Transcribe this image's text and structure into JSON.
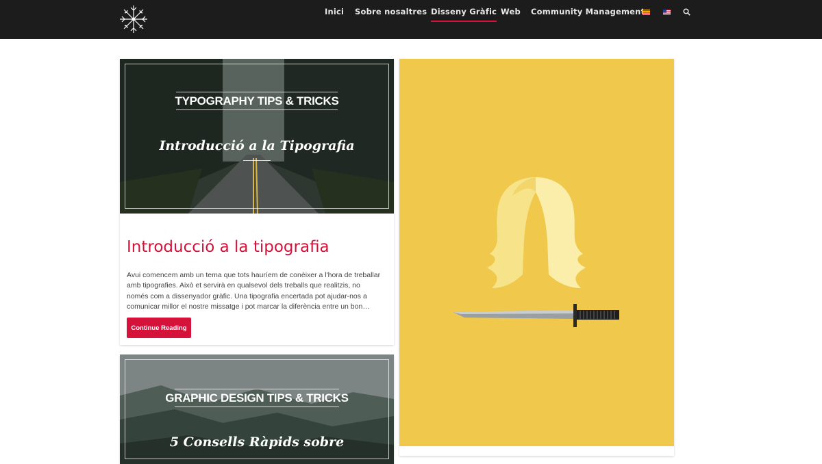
{
  "header": {
    "nav": [
      {
        "label": "Inici"
      },
      {
        "label": "Sobre nosaltres"
      },
      {
        "label": "Disseny Gràfic"
      },
      {
        "label": "Web"
      },
      {
        "label": "Community Management"
      }
    ],
    "active_nav": "Disseny Gràfic",
    "flags": [
      "catalan-flag",
      "us-flag"
    ],
    "icons": [
      "snowflake-logo",
      "search-icon"
    ]
  },
  "posts": [
    {
      "thumb_kicker": "TYPOGRAPHY TIPS & TRICKS",
      "thumb_title": "Introducció a la Tipografia",
      "title": "Introducció a la tipografia",
      "excerpt": "Avui comencem amb un tema que tots hauríem de conèixer a l'hora de treballar amb tipografies. Això et servirà en qualsevol dels treballs que realitzis, no només com a dissenyador gràfic. Una tipografia encertada pot ajudar-nos a comunicar millor el nostre missatge i pot marcar la diferència entre un bon…",
      "button": "Continue Reading"
    },
    {
      "thumb_kicker": "GRAPHIC DESIGN TIPS & TRICKS",
      "thumb_title": "5 Consells Ràpids sobre"
    }
  ],
  "colors": {
    "header_bg": "#1c1c1c",
    "accent": "#d4123a",
    "illustration_bg": "#f0c94c"
  }
}
